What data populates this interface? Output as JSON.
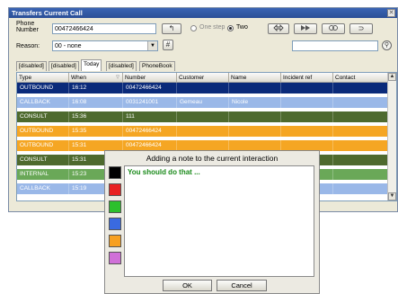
{
  "window": {
    "title": "Transfers Current Call",
    "close_glyph": "✕"
  },
  "form": {
    "phone_label_line1": "Phone",
    "phone_label_line2": "Number",
    "phone_value": "00472466424",
    "redial_glyph": "↰",
    "one_step_label": "One step",
    "two_label": "Two",
    "reason_label": "Reason:",
    "reason_value": "00 - none",
    "hash_glyph": "#",
    "redo_glyph": "⊃",
    "search_value": ""
  },
  "tabs": [
    "[disabled]",
    "[disabled]",
    "Today",
    "[disabled]",
    "PhoneBook"
  ],
  "active_tab_index": 2,
  "table": {
    "columns": [
      "Type",
      "When",
      "Number",
      "Customer",
      "Name",
      "Incident ref",
      "Contact"
    ],
    "rows": [
      {
        "cells": [
          "OUTBOUND",
          "16:12",
          "00472466424",
          "",
          "",
          "",
          ""
        ],
        "color": "#0a2a7a"
      },
      {
        "cells": [
          "CALLBACK",
          "16:08",
          "0031241001",
          "Gemeau",
          "Nicole",
          "",
          ""
        ],
        "color": "#9ab8e8"
      },
      {
        "cells": [
          "CONSULT",
          "15:36",
          "111",
          "",
          "",
          "",
          ""
        ],
        "color": "#4e6a2e"
      },
      {
        "cells": [
          "OUTBOUND",
          "15:35",
          "00472466424",
          "",
          "",
          "",
          ""
        ],
        "color": "#f5a623"
      },
      {
        "cells": [
          "OUTBOUND",
          "15:31",
          "00472466424",
          "",
          "",
          "",
          ""
        ],
        "color": "#f5a623"
      },
      {
        "cells": [
          "CONSULT",
          "15:31",
          "111",
          "",
          "",
          "",
          ""
        ],
        "color": "#4e6a2e"
      },
      {
        "cells": [
          "INTERNAL",
          "15:23",
          "",
          "",
          "",
          "",
          ""
        ],
        "color": "#6aa858"
      },
      {
        "cells": [
          "CALLBACK",
          "15:19",
          "",
          "",
          "",
          "",
          ""
        ],
        "color": "#9ab8e8"
      }
    ]
  },
  "dialog": {
    "title": "Adding a note to the current interaction",
    "note_text": "You should do that ...",
    "swatches": [
      "#000000",
      "#e82020",
      "#2cc02c",
      "#3a6ae0",
      "#f7a020",
      "#d070d8"
    ],
    "ok_label": "OK",
    "cancel_label": "Cancel"
  }
}
